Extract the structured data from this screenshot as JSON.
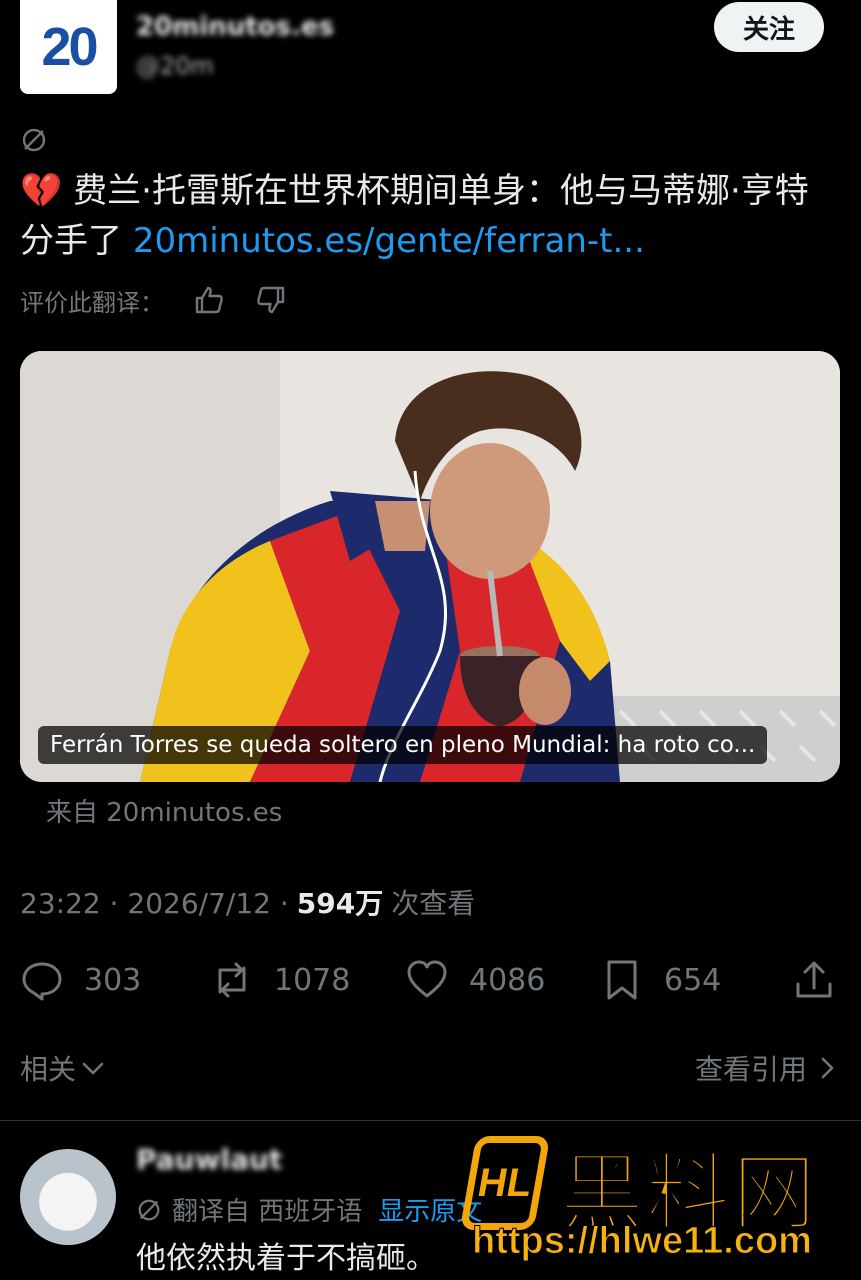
{
  "header": {
    "logo_text": "20",
    "account_name": "20minutos.es",
    "account_handle": "@20m",
    "follow_label": "关注"
  },
  "tweet": {
    "emoji": "💔",
    "text_main": " 费兰·托雷斯在世界杯期间单身：他与马蒂娜·亨特分手了 ",
    "link_text": "20minutos.es/gente/ferran-t...",
    "rate_label": "评价此翻译："
  },
  "card": {
    "caption": "Ferrán Torres se queda soltero en pleno Mundial: ha roto co...",
    "source": "来自 20minutos.es"
  },
  "meta": {
    "time_date": "23:22 · 2026/7/12 ·",
    "views": "594万",
    "views_label": "次查看"
  },
  "actions": {
    "replies": "303",
    "reposts": "1078",
    "likes": "4086",
    "bookmarks": "654"
  },
  "related": {
    "label": "相关",
    "view_quotes": "查看引用"
  },
  "reply": {
    "name": "Pauwlaut",
    "translated_from": "翻译自 西班牙语",
    "show_original": "显示原文",
    "text": "他依然执着于不搞砸。"
  },
  "watermark": {
    "title": "黑料网",
    "url": "https://hlwe11.com",
    "mark": "HL"
  },
  "colors": {
    "background": "#000000",
    "text_primary": "#e7e9ea",
    "text_secondary": "#71767b",
    "link": "#1d9bf0",
    "watermark": "#f2a60a"
  }
}
